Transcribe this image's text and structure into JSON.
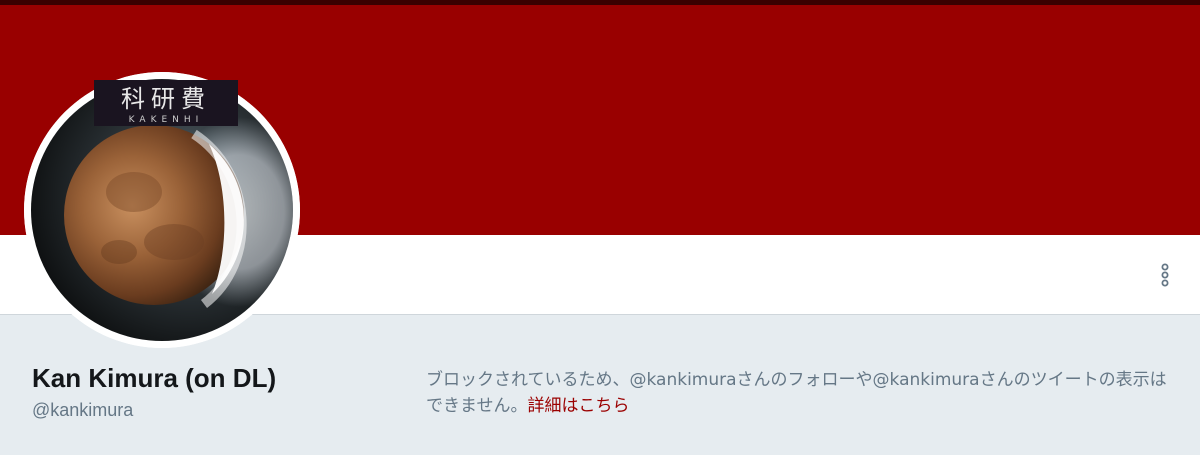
{
  "profile": {
    "display_name": "Kan Kimura (on DL)",
    "handle": "@kankimura",
    "banner_color": "#990000",
    "avatar_description_icon": "lunar-eclipse-moon",
    "avatar_logo_kanji": "科研費",
    "avatar_logo_sub": "KAKENHI"
  },
  "blocked_notice": {
    "part1": "ブロックされているため、",
    "handle1": "@kankimura",
    "part2": "さんのフォローや",
    "handle2": "@kankimura",
    "part3": "さんのツイートの表示はできません。",
    "learn_more": "詳細はこちら"
  },
  "toolbar": {
    "more_icon": "more-vertical-icon"
  },
  "colors": {
    "accent_link": "#9b0000",
    "secondary_text": "#657786",
    "background": "#e6ecf0"
  }
}
